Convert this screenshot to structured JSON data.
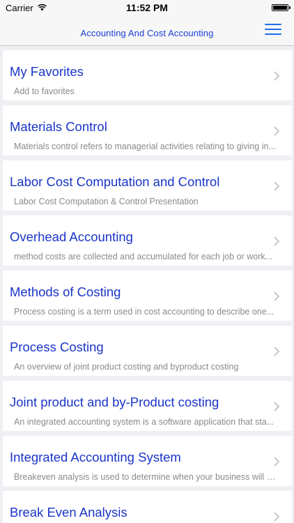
{
  "status_bar": {
    "carrier": "Carrier",
    "time": "11:52 PM"
  },
  "nav": {
    "title": "Accounting And Cost Accounting",
    "menu_icon": "hamburger-menu-icon",
    "accent_color": "#1e6ce8"
  },
  "items": [
    {
      "title": "My Favorites",
      "subtitle": "Add to favorites"
    },
    {
      "title": "Materials Control",
      "subtitle": "Materials control refers to managerial activities relating to giving in..."
    },
    {
      "title": "Labor Cost Computation and Control",
      "subtitle": "Labor Cost Computation & Control Presentation"
    },
    {
      "title": "Overhead Accounting",
      "subtitle": "method costs are collected and accumulated for each job or work..."
    },
    {
      "title": "Methods of Costing",
      "subtitle": "Process costing is a term used in cost accounting to describe one..."
    },
    {
      "title": "Process Costing",
      "subtitle": "An overview of joint product costing and byproduct costing"
    },
    {
      "title": "Joint product and by-Product costing",
      "subtitle": "An integrated accounting system is a software application that sta..."
    },
    {
      "title": "Integrated Accounting System",
      "subtitle": "Breakeven analysis is used to determine when your business will b..."
    },
    {
      "title": "Break Even Analysis",
      "subtitle": ""
    }
  ],
  "colors": {
    "title_text": "#1a35c8",
    "subtitle_text": "#8a8a8e",
    "background": "#efeff4",
    "chevron": "#c7c7cc"
  }
}
